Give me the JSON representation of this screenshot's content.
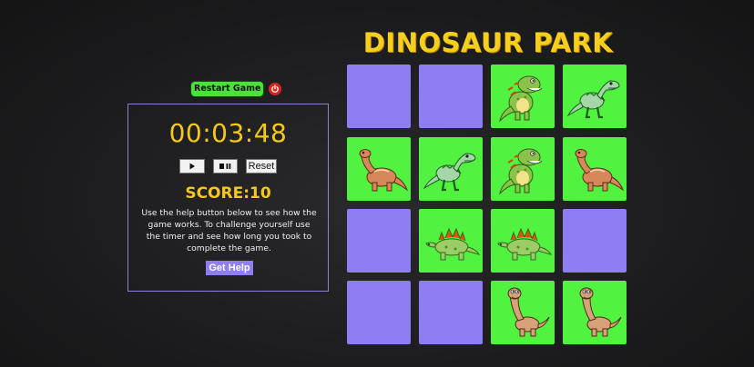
{
  "restart": {
    "label": "Restart Game",
    "icon": "power-icon"
  },
  "timer": {
    "value": "00:03:48"
  },
  "controls": {
    "play_icon": "play-icon",
    "pause_icon": "pause-icon",
    "reset_label": "Reset"
  },
  "score": {
    "label": "SCORE:10"
  },
  "help": {
    "text": "Use the help button below to see how the game works. To challenge yourself use the timer and see how long you took to complete the game.",
    "button_label": "Get Help"
  },
  "title": "DINOSAUR PARK",
  "colors": {
    "hidden_card": "#8e7ef4",
    "revealed_card": "#52f240",
    "accent_yellow": "#f6c81a",
    "panel_border": "#8f7fd8"
  },
  "cards": [
    {
      "state": "hidden"
    },
    {
      "state": "hidden"
    },
    {
      "state": "revealed",
      "dino": "t-rex-icon"
    },
    {
      "state": "revealed",
      "dino": "raptor-icon"
    },
    {
      "state": "revealed",
      "dino": "brontosaurus-icon"
    },
    {
      "state": "revealed",
      "dino": "raptor-icon"
    },
    {
      "state": "revealed",
      "dino": "t-rex-icon"
    },
    {
      "state": "revealed",
      "dino": "brontosaurus-icon"
    },
    {
      "state": "hidden"
    },
    {
      "state": "revealed",
      "dino": "stegosaurus-icon"
    },
    {
      "state": "revealed",
      "dino": "stegosaurus-icon"
    },
    {
      "state": "hidden"
    },
    {
      "state": "hidden"
    },
    {
      "state": "hidden"
    },
    {
      "state": "revealed",
      "dino": "diplodocus-icon"
    },
    {
      "state": "revealed",
      "dino": "diplodocus-icon"
    }
  ]
}
